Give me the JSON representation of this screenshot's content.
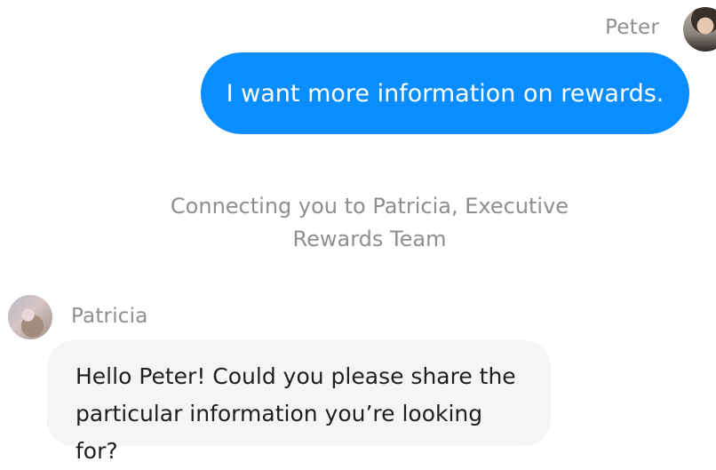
{
  "chat": {
    "outgoing": {
      "sender_name": "Peter",
      "avatar_icon": "user-avatar-icon",
      "message": "I want more information on rewards.",
      "bubble_color": "#0a8eff",
      "text_color": "#ffffff"
    },
    "system_message": "Connecting you to Patricia, Executive Rewards Team",
    "incoming": {
      "sender_name": "Patricia",
      "avatar_icon": "agent-avatar-icon",
      "message": "Hello Peter! Could you please share the particular information you’re looking for?",
      "bubble_color": "#f5f5f5",
      "text_color": "#1f1f1f"
    },
    "muted_text_color": "#8e8e93"
  }
}
